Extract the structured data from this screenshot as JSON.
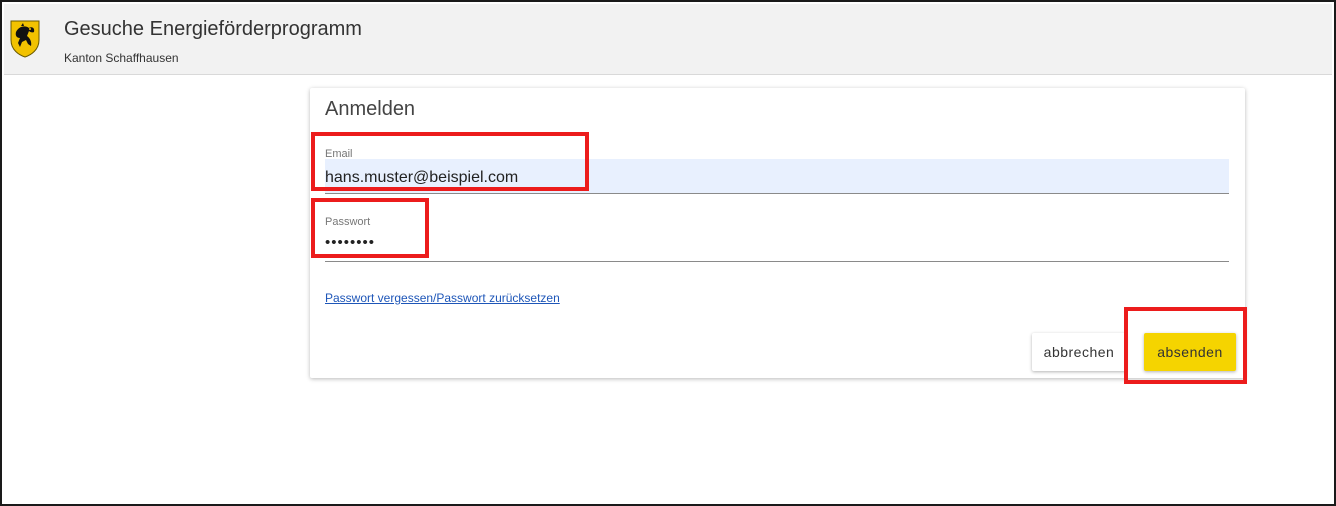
{
  "header": {
    "title": "Gesuche Energieförderprogramm",
    "subtitle": "Kanton Schaffhausen",
    "logo_icon": "schaffhausen-coat-of-arms-icon"
  },
  "login": {
    "title": "Anmelden",
    "email": {
      "label": "Email",
      "value": "hans.muster@beispiel.com"
    },
    "password": {
      "label": "Passwort",
      "value": "••••••••"
    },
    "forgot_link": "Passwort vergessen/Passwort zurücksetzen",
    "cancel_label": "abbrechen",
    "submit_label": "absenden"
  },
  "colors": {
    "submit_button": "#f5d400",
    "highlight": "#ec1c1c",
    "autofill": "#e8f0fe",
    "link": "#1e56b8"
  }
}
